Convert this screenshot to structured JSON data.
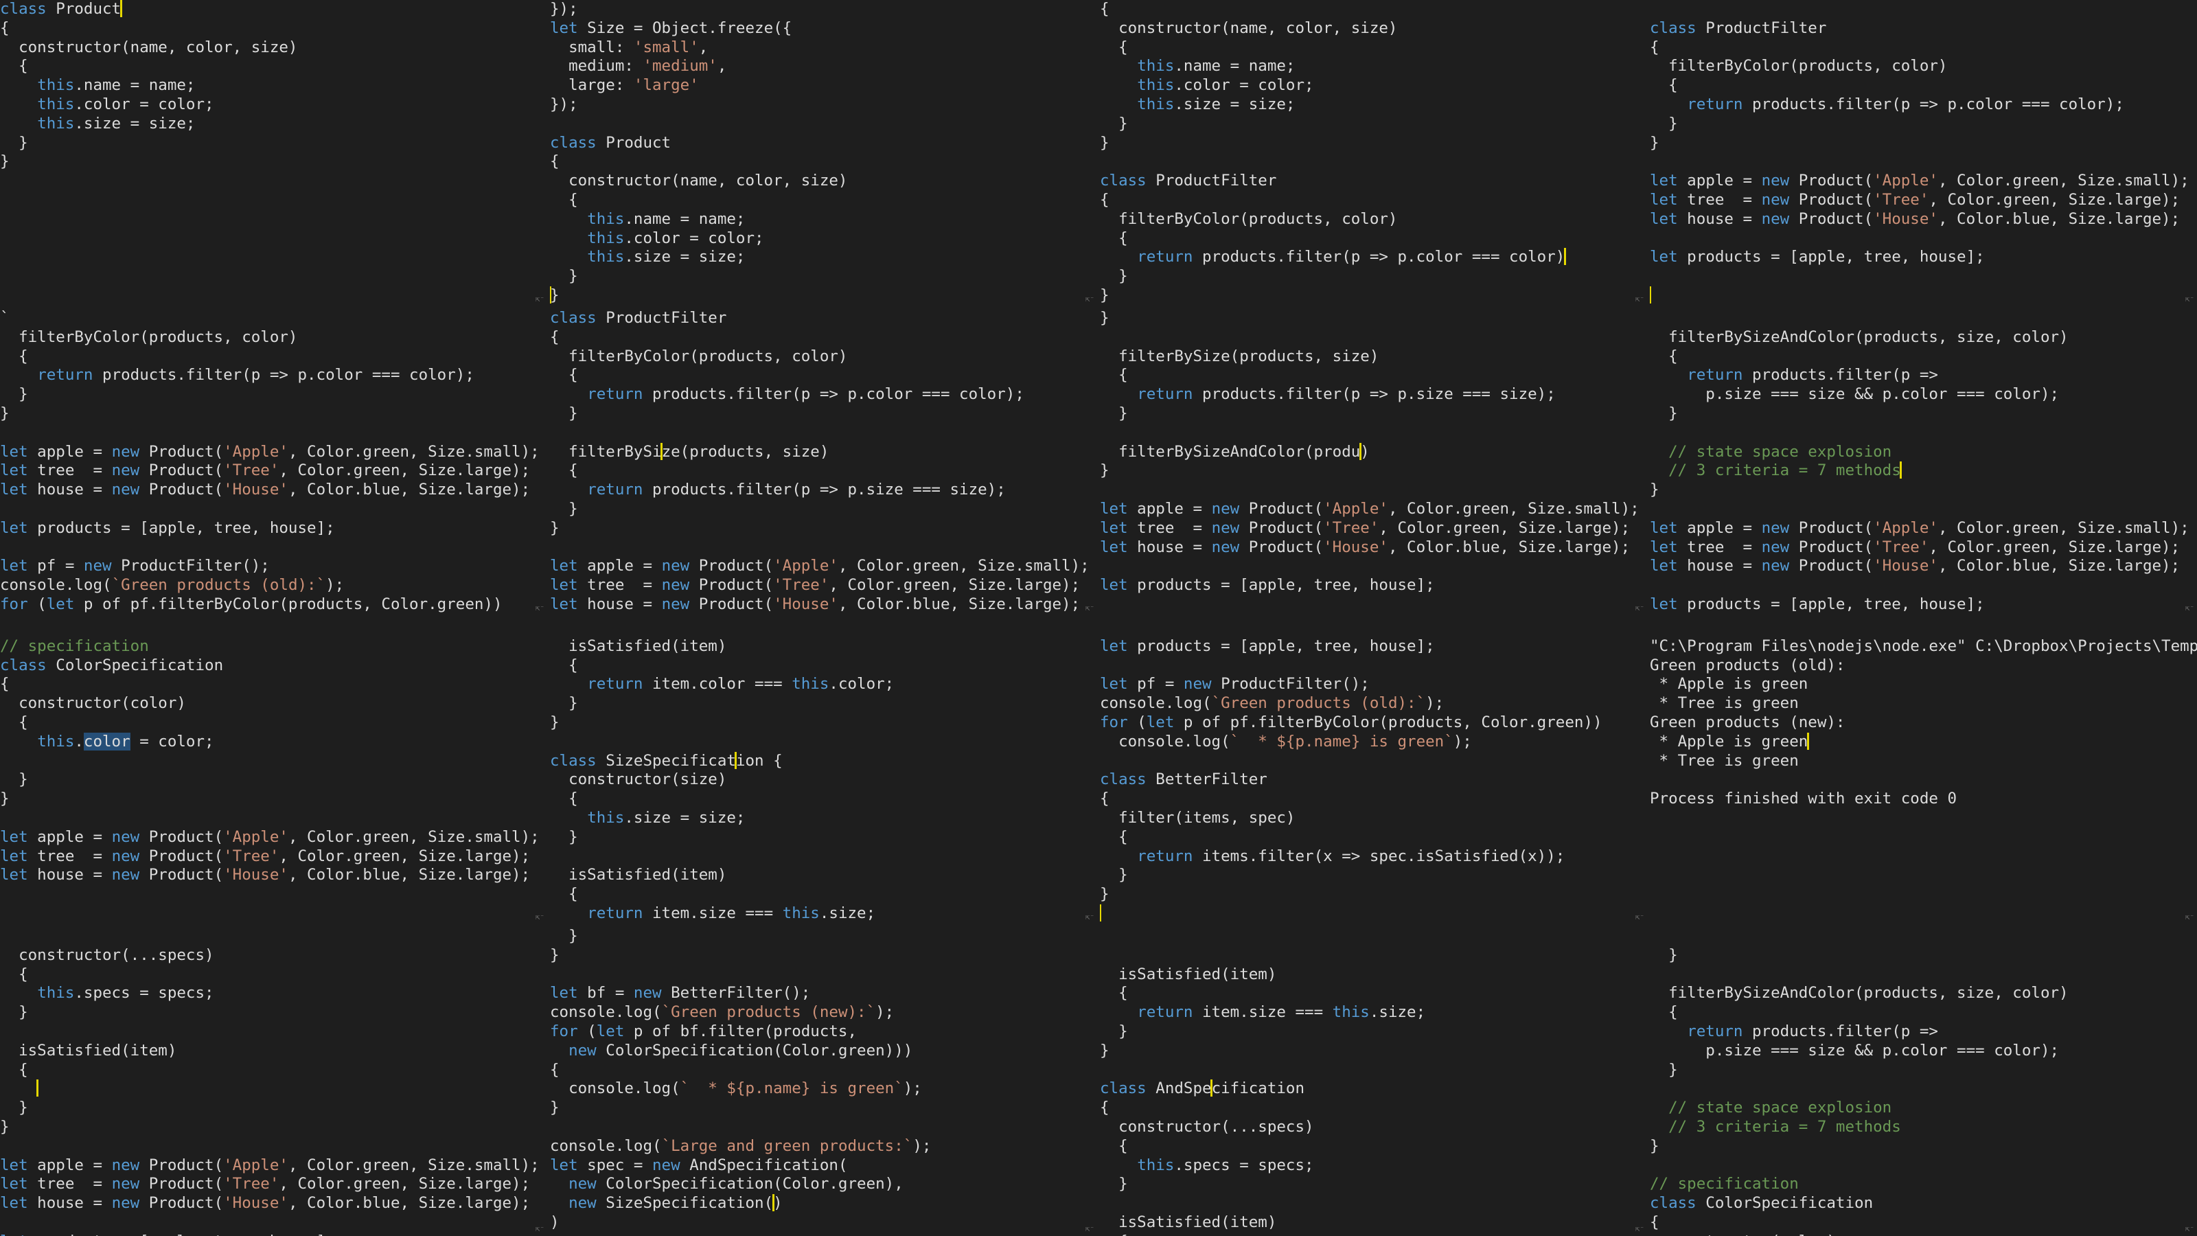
{
  "colors": {
    "background": "#1e1e1e",
    "text": "#dcdcdc",
    "keyword": "#569cd6",
    "string": "#ce9178",
    "comment": "#6a9955",
    "selection": "#264f78",
    "caret": "#e6d800"
  },
  "cells": [
    {
      "lines": [
        "[k]class[/k] Product[|]",
        "{",
        "  constructor(name, color, size)",
        "  {",
        "    [k]this[/k].name = name;",
        "    [k]this[/k].color = color;",
        "    [k]this[/k].size = size;",
        "  }",
        "}"
      ]
    },
    {
      "lines": [
        "});",
        "[k]let[/k] Size = Object.freeze({",
        "  small: [s]'small'[/s],",
        "  medium: [s]'medium'[/s],",
        "  large: [s]'large'[/s]",
        "});",
        "",
        "[k]class[/k] Product",
        "{",
        "  constructor(name, color, size)",
        "  {",
        "    [k]this[/k].name = name;",
        "    [k]this[/k].color = color;",
        "    [k]this[/k].size = size;",
        "  }",
        "[|]}"
      ]
    },
    {
      "lines": [
        "{",
        "  constructor(name, color, size)",
        "  {",
        "    [k]this[/k].name = name;",
        "    [k]this[/k].color = color;",
        "    [k]this[/k].size = size;",
        "  }",
        "}",
        "",
        "[k]class[/k] ProductFilter",
        "{",
        "  filterByColor(products, color)",
        "  {",
        "    [k]return[/k] products.filter(p => p.color === color)[|]",
        "  }",
        "}"
      ]
    },
    {
      "lines": [
        "",
        "[k]class[/k] ProductFilter",
        "{",
        "  filterByColor(products, color)",
        "  {",
        "    [k]return[/k] products.filter(p => p.color === color);",
        "  }",
        "}",
        "",
        "[k]let[/k] apple = [k]new[/k] Product([s]'Apple'[/s], Color.green, Size.small);",
        "[k]let[/k] tree  = [k]new[/k] Product([s]'Tree'[/s], Color.green, Size.large);",
        "[k]let[/k] house = [k]new[/k] Product([s]'House'[/s], Color.blue, Size.large);",
        "",
        "[k]let[/k] products = [apple, tree, house];",
        "",
        "[|]"
      ]
    },
    {
      "lines": [
        "`",
        "  filterByColor(products, color)",
        "  {",
        "    [k]return[/k] products.filter(p => p.color === color);",
        "  }",
        "}",
        "",
        "[k]let[/k] apple = [k]new[/k] Product([s]'Apple'[/s], Color.green, Size.small);",
        "[k]let[/k] tree  = [k]new[/k] Product([s]'Tree'[/s], Color.green, Size.large);",
        "[k]let[/k] house = [k]new[/k] Product([s]'House'[/s], Color.blue, Size.large);",
        "",
        "[k]let[/k] products = [apple, tree, house];",
        "",
        "[k]let[/k] pf = [k]new[/k] ProductFilter();",
        "console.log([s]`Green products (old):`[/s]);",
        "[k]for[/k] ([k]let[/k] p of pf.filterByColor(products, Color.green))",
        "  console.log([s]`  * ${p.name} is green`[/s]);",
        "}"
      ]
    },
    {
      "lines": [
        "[k]class[/k] ProductFilter",
        "{",
        "  filterByColor(products, color)",
        "  {",
        "    [k]return[/k] products.filter(p => p.color === color);",
        "  }",
        "",
        "  filterBySi[|]ze(products, size)",
        "  {",
        "    [k]return[/k] products.filter(p => p.size === size);",
        "  }",
        "}",
        "",
        "[k]let[/k] apple = [k]new[/k] Product([s]'Apple'[/s], Color.green, Size.small);",
        "[k]let[/k] tree  = [k]new[/k] Product([s]'Tree'[/s], Color.green, Size.large);",
        "[k]let[/k] house = [k]new[/k] Product([s]'House'[/s], Color.blue, Size.large);"
      ]
    },
    {
      "lines": [
        "}",
        "",
        "  filterBySize(products, size)",
        "  {",
        "    [k]return[/k] products.filter(p => p.size === size);",
        "  }",
        "",
        "  filterBySizeAndColor(produ[|])",
        "}",
        "",
        "[k]let[/k] apple = [k]new[/k] Product([s]'Apple'[/s], Color.green, Size.small);",
        "[k]let[/k] tree  = [k]new[/k] Product([s]'Tree'[/s], Color.green, Size.large);",
        "[k]let[/k] house = [k]new[/k] Product([s]'House'[/s], Color.blue, Size.large);",
        "",
        "[k]let[/k] products = [apple, tree, house];"
      ]
    },
    {
      "lines": [
        "",
        "  filterBySizeAndColor(products, size, color)",
        "  {",
        "    [k]return[/k] products.filter(p =>",
        "      p.size === size && p.color === color);",
        "  }",
        "",
        "  [c]// state space explosion[/c]",
        "  [c]// 3 criteria = 7 methods[/c][|]",
        "}",
        "",
        "[k]let[/k] apple = [k]new[/k] Product([s]'Apple'[/s], Color.green, Size.small);",
        "[k]let[/k] tree  = [k]new[/k] Product([s]'Tree'[/s], Color.green, Size.large);",
        "[k]let[/k] house = [k]new[/k] Product([s]'House'[/s], Color.blue, Size.large);",
        "",
        "[k]let[/k] products = [apple, tree, house];"
      ]
    },
    {
      "lines": [
        "",
        "[c]// specification[/c]",
        "[k]class[/k] ColorSpecification",
        "{",
        "  constructor(color)",
        "  {",
        "    [k]this[/k].[h]color[/h] = color;",
        "",
        "  }",
        "}",
        "",
        "[k]let[/k] apple = [k]new[/k] Product([s]'Apple'[/s], Color.green, Size.small);",
        "[k]let[/k] tree  = [k]new[/k] Product([s]'Tree'[/s], Color.green, Size.large);",
        "[k]let[/k] house = [k]new[/k] Product([s]'House'[/s], Color.blue, Size.large);"
      ]
    },
    {
      "lines": [
        "",
        "  isSatisfied(item)",
        "  {",
        "    [k]return[/k] item.color === [k]this[/k].color;",
        "  }",
        "}",
        "",
        "[k]class[/k] SizeSpecificat[|]ion {",
        "  constructor(size)",
        "  {",
        "    [k]this[/k].size = size;",
        "  }",
        "",
        "  isSatisfied(item)",
        "  {",
        "    [k]return[/k] item.size === [k]this[/k].size;"
      ]
    },
    {
      "lines": [
        "",
        "[k]let[/k] products = [apple, tree, house];",
        "",
        "[k]let[/k] pf = [k]new[/k] ProductFilter();",
        "console.log([s]`Green products (old):`[/s]);",
        "[k]for[/k] ([k]let[/k] p of pf.filterByColor(products, Color.green))",
        "  console.log([s]`  * ${p.name} is green`[/s]);",
        "",
        "[k]class[/k] BetterFilter",
        "{",
        "  filter(items, spec)",
        "  {",
        "    [k]return[/k] items.filter(x => spec.isSatisfied(x));",
        "  }",
        "}",
        "[|]"
      ]
    },
    {
      "lines": [
        "",
        "\"C:\\Program Files\\nodejs\\node.exe\" C:\\Dropbox\\Projects\\Temp\\j",
        "Green products (old):",
        " * Apple is green",
        " * Tree is green",
        "Green products (new):",
        " * Apple is green[|]",
        " * Tree is green",
        "",
        "Process finished with exit code 0"
      ]
    },
    {
      "lines": [
        "",
        "  constructor(...specs)",
        "  {",
        "    [k]this[/k].specs = specs;",
        "  }",
        "",
        "  isSatisfied(item)",
        "  {",
        "    [|]",
        "  }",
        "}",
        "",
        "[k]let[/k] apple = [k]new[/k] Product([s]'Apple'[/s], Color.green, Size.small);",
        "[k]let[/k] tree  = [k]new[/k] Product([s]'Tree'[/s], Color.green, Size.large);",
        "[k]let[/k] house = [k]new[/k] Product([s]'House'[/s], Color.blue, Size.large);",
        "",
        "[k]let[/k] products = [apple, tree, house];"
      ]
    },
    {
      "lines": [
        "  }",
        "}",
        "",
        "[k]let[/k] bf = [k]new[/k] BetterFilter();",
        "console.log([s]`Green products (new):`[/s]);",
        "[k]for[/k] ([k]let[/k] p of bf.filter(products,",
        "  [k]new[/k] ColorSpecification(Color.green)))",
        "{",
        "  console.log([s]`  * ${p.name} is green`[/s]);",
        "}",
        "",
        "console.log([s]`Large and green products:`[/s]);",
        "[k]let[/k] spec = [k]new[/k] AndSpecification(",
        "  [k]new[/k] ColorSpecification(Color.green),",
        "  [k]new[/k] SizeSpecification([|])",
        ")"
      ]
    },
    {
      "lines": [
        "",
        "",
        "  isSatisfied(item)",
        "  {",
        "    [k]return[/k] item.size === [k]this[/k].size;",
        "  }",
        "}",
        "",
        "[k]class[/k] AndSpe[|]cification",
        "{",
        "  constructor(...specs)",
        "  {",
        "    [k]this[/k].specs = specs;",
        "  }",
        "",
        "  isSatisfied(item)",
        "  {"
      ]
    },
    {
      "lines": [
        "",
        "  }",
        "",
        "  filterBySizeAndColor(products, size, color)",
        "  {",
        "    [k]return[/k] products.filter(p =>",
        "      p.size === size && p.color === color);",
        "  }",
        "",
        "  [c]// state space explosion[/c]",
        "  [c]// 3 criteria = 7 methods[/c]",
        "}",
        "",
        "[c]// specification[/c]",
        "[k]class[/k] ColorSpecification",
        "{",
        "  constructor(color)"
      ]
    }
  ]
}
